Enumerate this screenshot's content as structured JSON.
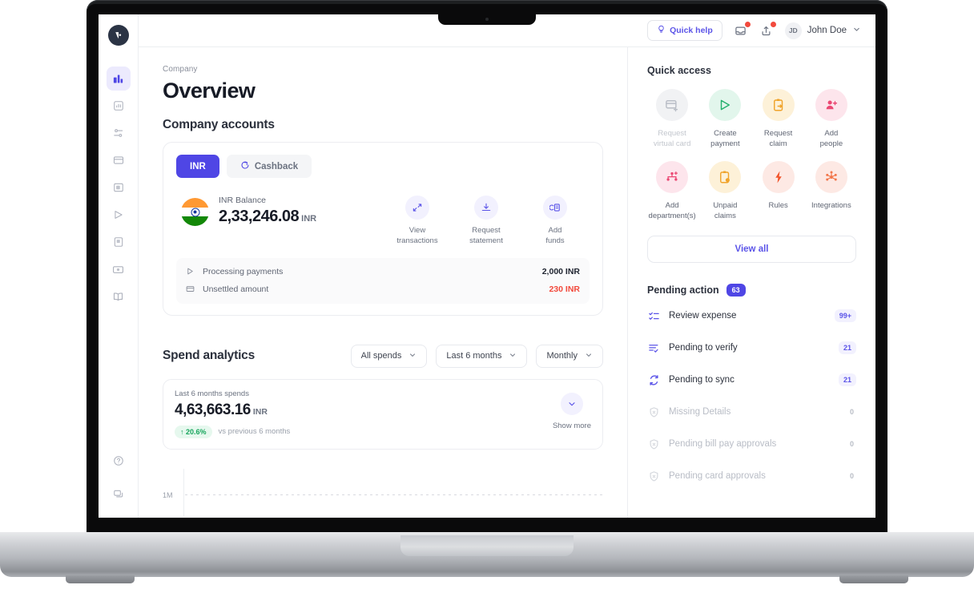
{
  "topbar": {
    "quick_help": "Quick help",
    "user_initials": "JD",
    "user_name": "John Doe"
  },
  "breadcrumb": "Company",
  "page_title": "Overview",
  "company_accounts": {
    "heading": "Company accounts",
    "tabs": [
      {
        "label": "INR",
        "active": true
      },
      {
        "label": "Cashback",
        "active": false
      }
    ],
    "balance_label": "INR Balance",
    "balance_amount": "2,33,246.08",
    "balance_currency": "INR",
    "actions": [
      {
        "label_line1": "View",
        "label_line2": "transactions"
      },
      {
        "label_line1": "Request",
        "label_line2": "statement"
      },
      {
        "label_line1": "Add",
        "label_line2": "funds"
      }
    ],
    "rows": [
      {
        "label": "Processing payments",
        "value": "2,000 INR",
        "negative": false
      },
      {
        "label": "Unsettled amount",
        "value": "230 INR",
        "negative": true
      }
    ]
  },
  "spend_analytics": {
    "heading": "Spend analytics",
    "filters": [
      {
        "label": "All spends"
      },
      {
        "label": "Last 6 months"
      },
      {
        "label": "Monthly"
      }
    ],
    "summary_label": "Last 6 months spends",
    "summary_amount": "4,63,663.16",
    "summary_currency": "INR",
    "delta": "20.6%",
    "delta_direction": "up",
    "delta_note": "vs previous 6 months",
    "show_more": "Show more"
  },
  "chart_data": {
    "type": "bar",
    "title": "Spend analytics",
    "categories": [],
    "values": [],
    "ytick_labels": [
      "1M"
    ],
    "ylabel": "",
    "xlabel": "",
    "grid": true,
    "note": "Chart is cut off by the viewport; only the 1M gridline and axis are visible."
  },
  "quick_access": {
    "heading": "Quick access",
    "items": [
      {
        "label_line1": "Request",
        "label_line2": "virtual card",
        "bg": "#f1f2f4",
        "fg": "#b9bdc6",
        "disabled": true,
        "icon": "card-plus-icon"
      },
      {
        "label_line1": "Create",
        "label_line2": "payment",
        "bg": "#e2f6ec",
        "fg": "#25b06e",
        "disabled": false,
        "icon": "send-icon"
      },
      {
        "label_line1": "Request",
        "label_line2": "claim",
        "bg": "#fdf1d8",
        "fg": "#f0a32a",
        "disabled": false,
        "icon": "clipboard-arrow-icon"
      },
      {
        "label_line1": "Add",
        "label_line2": "people",
        "bg": "#fde5ec",
        "fg": "#eb4873",
        "disabled": false,
        "icon": "user-plus-icon"
      },
      {
        "label_line1": "Add",
        "label_line2": "department(s)",
        "bg": "#fde5ec",
        "fg": "#eb4873",
        "disabled": false,
        "icon": "org-chart-icon"
      },
      {
        "label_line1": "Unpaid",
        "label_line2": "claims",
        "bg": "#fdf1d8",
        "fg": "#f0a32a",
        "disabled": false,
        "icon": "clipboard-clock-icon"
      },
      {
        "label_line1": "Rules",
        "label_line2": "",
        "bg": "#fde9e4",
        "fg": "#f2542a",
        "disabled": false,
        "icon": "bolt-icon"
      },
      {
        "label_line1": "Integrations",
        "label_line2": "",
        "bg": "#fde9e4",
        "fg": "#f2764a",
        "disabled": false,
        "icon": "integrations-icon"
      }
    ],
    "view_all": "View all"
  },
  "pending_action": {
    "heading": "Pending action",
    "count": "63",
    "rows": [
      {
        "label": "Review expense",
        "value": "99+",
        "muted": false,
        "icon": "checklist-icon"
      },
      {
        "label": "Pending to verify",
        "value": "21",
        "muted": false,
        "icon": "list-check-icon"
      },
      {
        "label": "Pending to sync",
        "value": "21",
        "muted": false,
        "icon": "sync-icon"
      },
      {
        "label": "Missing Details",
        "value": "0",
        "muted": true,
        "icon": "shield-icon"
      },
      {
        "label": "Pending bill pay approvals",
        "value": "0",
        "muted": true,
        "icon": "shield-icon"
      },
      {
        "label": "Pending card approvals",
        "value": "0",
        "muted": true,
        "icon": "shield-icon"
      }
    ]
  },
  "sidebar": {
    "logo": "company-logo",
    "items": [
      {
        "name": "overview",
        "icon": "dashboard-icon",
        "active": true
      },
      {
        "name": "analytics",
        "icon": "chart-icon",
        "active": false
      },
      {
        "name": "transactions",
        "icon": "list-settings-icon",
        "active": false
      },
      {
        "name": "cards",
        "icon": "card-icon",
        "active": false
      },
      {
        "name": "accounts",
        "icon": "wallet-icon",
        "active": false
      },
      {
        "name": "payments",
        "icon": "send-icon",
        "active": false
      },
      {
        "name": "bills",
        "icon": "receipt-icon",
        "active": false
      },
      {
        "name": "reimbursements",
        "icon": "money-icon",
        "active": false
      },
      {
        "name": "ledger",
        "icon": "book-icon",
        "active": false
      }
    ],
    "bottom_items": [
      {
        "name": "help",
        "icon": "question-icon"
      },
      {
        "name": "support-chat",
        "icon": "chat-icon"
      }
    ]
  },
  "colors": {
    "accent": "#4f46e5",
    "accent_soft": "#f2f1fe",
    "danger": "#f2493c",
    "success": "#17a55c",
    "text": "#171b26",
    "muted": "#6b7280"
  }
}
